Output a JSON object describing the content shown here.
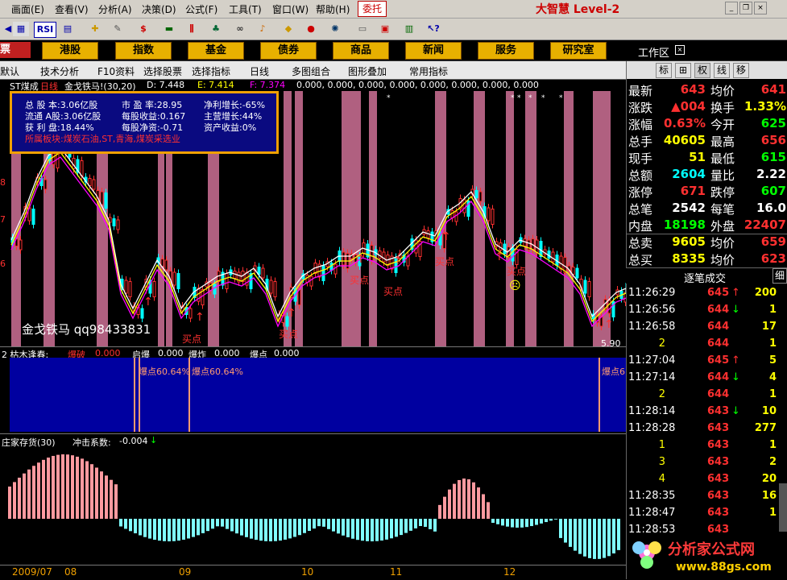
{
  "menu": {
    "items": [
      "画面(E)",
      "查看(V)",
      "分析(A)",
      "决策(D)",
      "公式(F)",
      "工具(T)",
      "窗口(W)",
      "帮助(H)"
    ],
    "weituo": "委托",
    "brand": "大智慧 Level-2"
  },
  "toolbar": {
    "rsi_label": "RSI",
    "dollar_label": "$"
  },
  "categories": [
    "港股",
    "指数",
    "基金",
    "债券",
    "商品",
    "新闻",
    "服务",
    "研究室"
  ],
  "left_stub": "票",
  "workzone": "工作区",
  "tabs": [
    "默认",
    "技术分析",
    "F10资料",
    "选择股票",
    "选择指标",
    "日线",
    "多图组合",
    "图形叠加",
    "常用指标"
  ],
  "right_tabs": [
    "标",
    "⊞",
    "权",
    "线",
    "移"
  ],
  "chart_header": {
    "name": "ST煤成",
    "period": "日线",
    "indicator": "金戈铁马!(30,20)",
    "D": "D: 7.448",
    "E": "E: 7.414",
    "F": "F: 7.374",
    "zeros": "0.000, 0.000, 0.000, 0.000, 0.000, 0.000, 0.000, 0.000"
  },
  "info_box": {
    "total_shares": "总 股 本:3.06亿股",
    "pe": "市 盈 率:28.95",
    "profit_growth": "净利增长:-65%",
    "float_a": "流通 A股:3.06亿股",
    "eps": "每股收益:0.167",
    "revenue_growth": "主营增长:44%",
    "profit_rate": "获 利 盘:18.44%",
    "nav": "每股净资:-0.71",
    "roe": "资产收益:0%",
    "sectors": "所属板块:煤炭石油,ST,青海,煤炭采选业"
  },
  "main_chart": {
    "signal_label": "买点",
    "watermark": "金戈铁马 qq98433831",
    "low_price_label": "5.90",
    "price_axis": [
      "8",
      "7",
      "6"
    ]
  },
  "panel2": {
    "title": "2 枯木逢春:",
    "legend": [
      {
        "name": "爆破",
        "value": "0.000"
      },
      {
        "name": "启爆",
        "value": "0.000"
      },
      {
        "name": "爆炸",
        "value": "0.000"
      },
      {
        "name": "爆点",
        "value": "0.000"
      }
    ],
    "label": "爆点60.64%",
    "label_short": "爆点6"
  },
  "panel3": {
    "title": "庄家存货(30)",
    "coef_label": "冲击系数:",
    "coef_value": "-0.004"
  },
  "x_axis": {
    "year": "2009/07",
    "labels": [
      "08",
      "09",
      "10",
      "11",
      "12"
    ]
  },
  "quote": [
    {
      "l1": "最新",
      "v1": "643",
      "c1": "#ff3030",
      "l2": "均价",
      "v2": "641",
      "c2": "#ff3030"
    },
    {
      "l1": "涨跌",
      "v1": "▲004",
      "c1": "#ff3030",
      "l2": "换手",
      "v2": "1.33%",
      "c2": "#ffff00"
    },
    {
      "l1": "涨幅",
      "v1": "0.63%",
      "c1": "#ff3030",
      "l2": "今开",
      "v2": "625",
      "c2": "#00ff00"
    },
    {
      "l1": "总手",
      "v1": "40605",
      "c1": "#ffff00",
      "l2": "最高",
      "v2": "656",
      "c2": "#ff3030"
    },
    {
      "l1": "现手",
      "v1": "51",
      "c1": "#ffff00",
      "l2": "最低",
      "v2": "615",
      "c2": "#00ff00"
    },
    {
      "l1": "总额",
      "v1": "2604",
      "c1": "#00ffff",
      "l2": "量比",
      "v2": "2.22",
      "c2": "#ffffff"
    },
    {
      "l1": "涨停",
      "v1": "671",
      "c1": "#ff3030",
      "l2": "跌停",
      "v2": "607",
      "c2": "#00ff00"
    },
    {
      "l1": "总笔",
      "v1": "2542",
      "c1": "#ffffff",
      "l2": "每笔",
      "v2": "16.0",
      "c2": "#ffffff"
    },
    {
      "l1": "内盘",
      "v1": "18198",
      "c1": "#00ff00",
      "l2": "外盘",
      "v2": "22407",
      "c2": "#ff3030"
    },
    {
      "l1": "总卖",
      "v1": "9605",
      "c1": "#ffff00",
      "l2": "均价",
      "v2": "659",
      "c2": "#ff3030"
    },
    {
      "l1": "总买",
      "v1": "8335",
      "c1": "#ffff00",
      "l2": "均价",
      "v2": "623",
      "c2": "#ff3030"
    }
  ],
  "tick_header": {
    "title": "逐笔成交",
    "detail": "细"
  },
  "ticks": [
    {
      "time": "11:26:29",
      "price": "645",
      "dir": "↑",
      "vol": "200",
      "pc": "#ff3030"
    },
    {
      "time": "11:26:56",
      "price": "644",
      "dir": "↓",
      "vol": "1",
      "pc": "#ff3030"
    },
    {
      "time": "11:26:58",
      "price": "644",
      "dir": "",
      "vol": "17",
      "pc": "#ff3030"
    },
    {
      "time": "",
      "price": "644",
      "dir": "",
      "vol": "1",
      "pc": "#ff3030"
    },
    {
      "time": "11:27:04",
      "price": "645",
      "dir": "↑",
      "vol": "5",
      "pc": "#ff3030"
    },
    {
      "time": "11:27:14",
      "price": "644",
      "dir": "↓",
      "vol": "4",
      "pc": "#ff3030"
    },
    {
      "time": "",
      "price": "644",
      "dir": "",
      "vol": "1",
      "pc": "#ff3030"
    },
    {
      "time": "11:28:14",
      "price": "643",
      "dir": "↓",
      "vol": "10",
      "pc": "#ff3030"
    },
    {
      "time": "11:28:28",
      "price": "643",
      "dir": "",
      "vol": "277",
      "pc": "#ff3030"
    },
    {
      "time": "",
      "price": "643",
      "dir": "",
      "vol": "1",
      "pc": "#ff3030"
    },
    {
      "time": "",
      "price": "643",
      "dir": "",
      "vol": "2",
      "pc": "#ff3030"
    },
    {
      "time": "",
      "price": "643",
      "dir": "",
      "vol": "20",
      "pc": "#ff3030"
    },
    {
      "time": "11:28:35",
      "price": "643",
      "dir": "",
      "vol": "16",
      "pc": "#ff3030"
    },
    {
      "time": "11:28:47",
      "price": "643",
      "dir": "",
      "vol": "1",
      "pc": "#ff3030"
    },
    {
      "time": "11:28:53",
      "price": "643",
      "dir": "",
      "vol": "",
      "pc": "#ff3030"
    }
  ],
  "tick_counts_index": [
    "1",
    "3",
    "4"
  ],
  "logo": {
    "text": "分析家公式网",
    "url": "www.88gs.com"
  }
}
